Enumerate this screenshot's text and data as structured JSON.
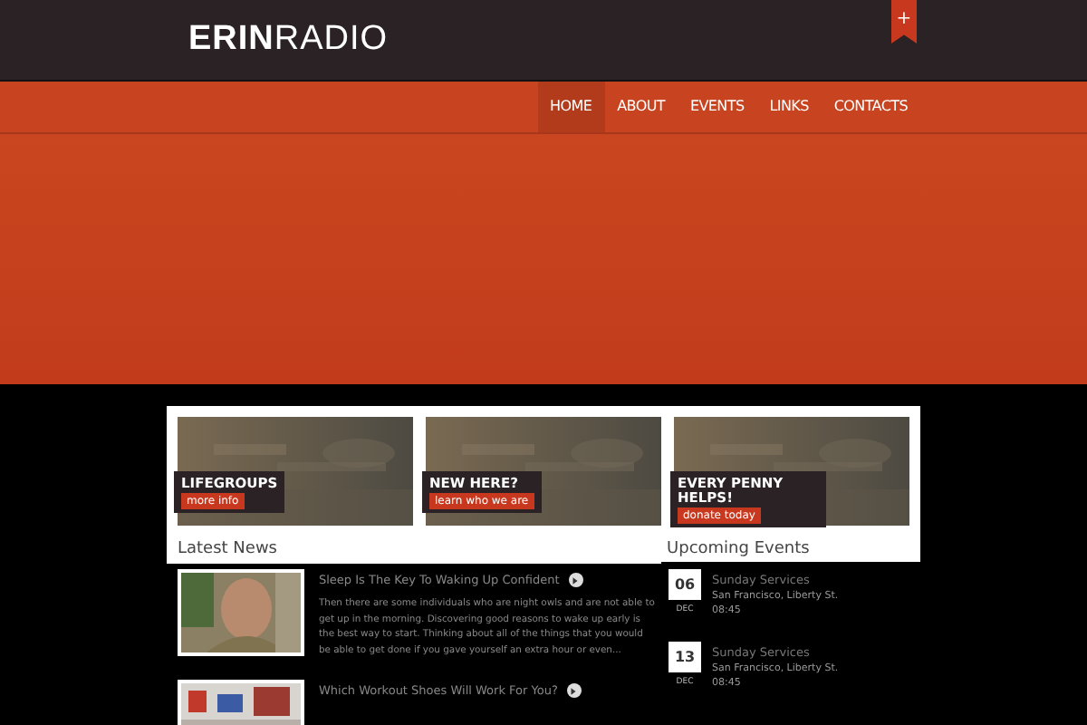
{
  "logo": {
    "bold": "ERIN",
    "light": "RADIO"
  },
  "ribbon": {
    "label": "+"
  },
  "nav": [
    {
      "label": "HOME",
      "selected": true
    },
    {
      "label": "ABOUT",
      "selected": false
    },
    {
      "label": "EVENTS",
      "selected": false
    },
    {
      "label": "LINKS",
      "selected": false
    },
    {
      "label": "CONTACTS",
      "selected": false
    }
  ],
  "promos": [
    {
      "title": "LIFEGROUPS",
      "button": "more info"
    },
    {
      "title": "NEW HERE?",
      "button": "learn who we are"
    },
    {
      "title": "EVERY PENNY HELPS!",
      "button": "donate today"
    }
  ],
  "news": {
    "heading": "Latest News",
    "items": [
      {
        "title": "Sleep Is The Key To Waking Up Confident",
        "excerpt": "Then there are some individuals who are night owls and are not able to get up in the morning. Discovering good reasons to wake up early is the best way to start. Thinking about all of the things that you would be able to get done if you gave yourself an extra hour or even..."
      },
      {
        "title": "Which Workout Shoes Will Work For You?"
      }
    ]
  },
  "events": {
    "heading": "Upcoming Events",
    "items": [
      {
        "day": "06",
        "month": "DEC",
        "title": "Sunday Services",
        "place": "San Francisco, Liberty St.",
        "time": "08:45"
      },
      {
        "day": "13",
        "month": "DEC",
        "title": "Sunday Services",
        "place": "San Francisco, Liberty St.",
        "time": "08:45"
      }
    ]
  }
}
